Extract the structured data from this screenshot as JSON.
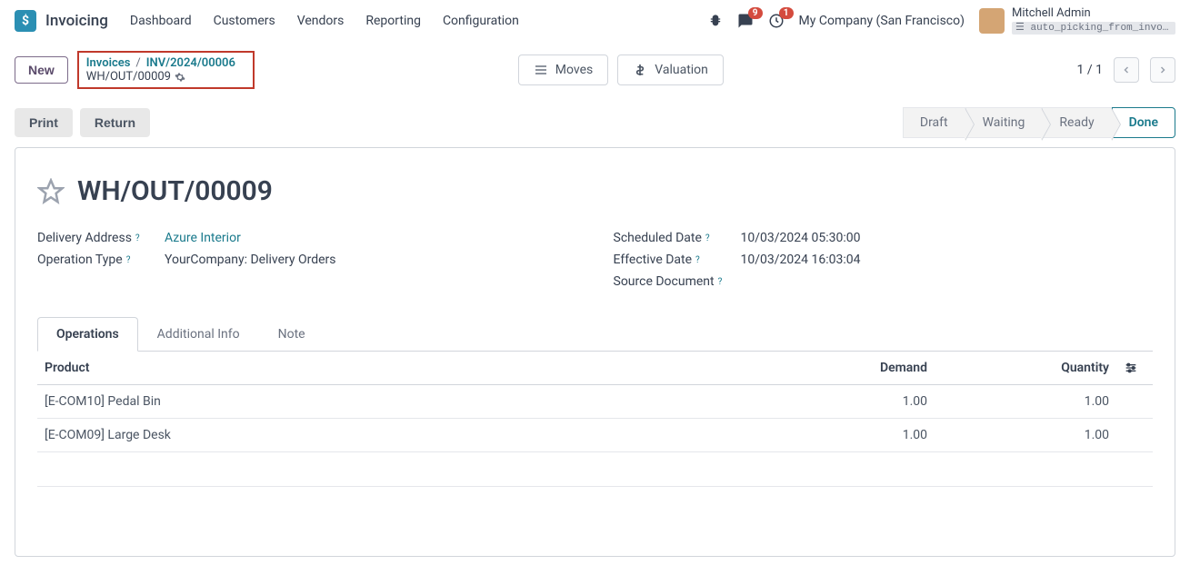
{
  "app": {
    "name": "Invoicing"
  },
  "nav": {
    "dashboard": "Dashboard",
    "customers": "Customers",
    "vendors": "Vendors",
    "reporting": "Reporting",
    "configuration": "Configuration"
  },
  "top": {
    "msg_count": "9",
    "activity_count": "1",
    "company": "My Company (San Francisco)",
    "user_name": "Mitchell Admin",
    "db_name": "auto_picking_from_invoic..."
  },
  "subheader": {
    "new": "New",
    "bc_root": "Invoices",
    "bc_parent": "INV/2024/00006",
    "bc_current": "WH/OUT/00009",
    "moves": "Moves",
    "valuation": "Valuation",
    "pager": "1 / 1"
  },
  "toolbar": {
    "print": "Print",
    "return": "Return"
  },
  "status": {
    "draft": "Draft",
    "waiting": "Waiting",
    "ready": "Ready",
    "done": "Done"
  },
  "record": {
    "title": "WH/OUT/00009",
    "labels": {
      "delivery_address": "Delivery Address",
      "operation_type": "Operation Type",
      "scheduled_date": "Scheduled Date",
      "effective_date": "Effective Date",
      "source_document": "Source Document"
    },
    "values": {
      "delivery_address": "Azure Interior",
      "operation_type": "YourCompany: Delivery Orders",
      "scheduled_date": "10/03/2024 05:30:00",
      "effective_date": "10/03/2024 16:03:04",
      "source_document": ""
    }
  },
  "tabs": {
    "operations": "Operations",
    "additional_info": "Additional Info",
    "note": "Note"
  },
  "table": {
    "headers": {
      "product": "Product",
      "demand": "Demand",
      "quantity": "Quantity"
    },
    "rows": [
      {
        "product": "[E-COM10] Pedal Bin",
        "demand": "1.00",
        "quantity": "1.00"
      },
      {
        "product": "[E-COM09] Large Desk",
        "demand": "1.00",
        "quantity": "1.00"
      }
    ]
  }
}
